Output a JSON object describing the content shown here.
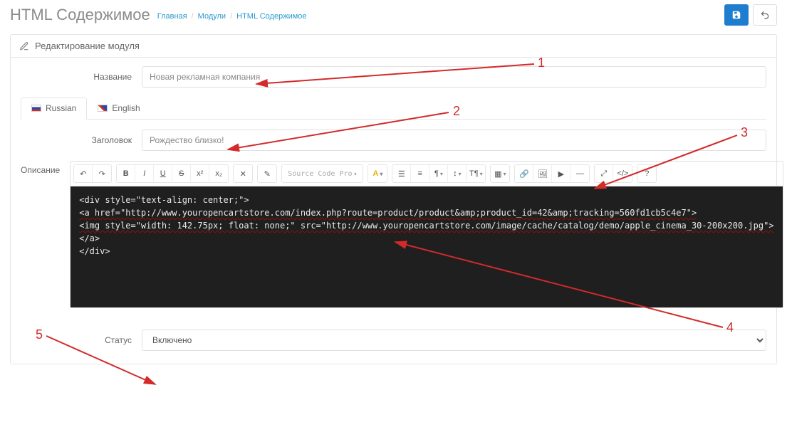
{
  "header": {
    "title": "HTML Содержимое",
    "crumbs": [
      "Главная",
      "Модули",
      "HTML Содержимое"
    ]
  },
  "panel": {
    "title": "Редактирование модуля"
  },
  "form": {
    "name_label": "Название",
    "name_value": "Новая рекламная компания",
    "heading_label": "Заголовок",
    "heading_value": "Рождество близко!",
    "desc_label": "Описание",
    "status_label": "Статус",
    "status_value": "Включено"
  },
  "tabs": {
    "russian": "Russian",
    "english": "English"
  },
  "toolbar": {
    "font_name": "Source Code Pro"
  },
  "code_lines": [
    "<div style=\"text-align: center;\">",
    "<a href=\"http://www.youropencartstore.com/index.php?route=product/product&amp;product_id=42&amp;tracking=560fd1cb5c4e7\">",
    "<img style=\"width: 142.75px; float: none;\" src=\"http://www.youropencartstore.com/image/cache/catalog/demo/apple_cinema_30-200x200.jpg\">",
    "</a>",
    "</div>"
  ],
  "anno": {
    "n1": "1",
    "n2": "2",
    "n3": "3",
    "n4": "4",
    "n5": "5"
  }
}
